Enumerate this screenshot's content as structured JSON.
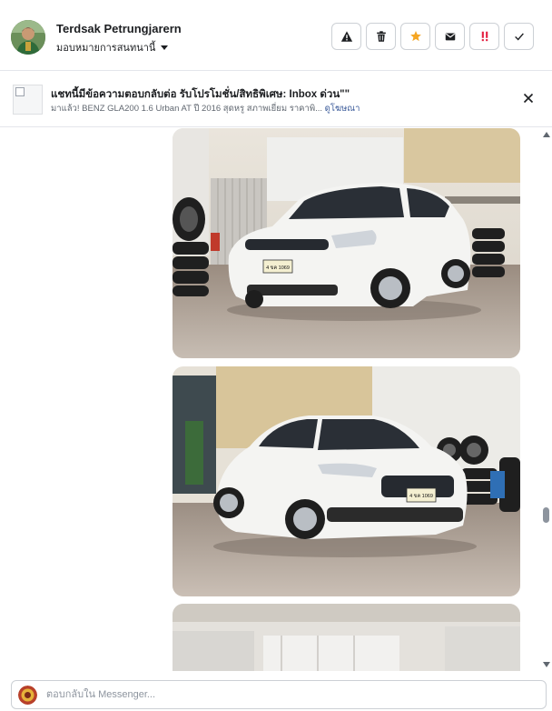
{
  "header": {
    "name": "Terdsak Petrungjarern",
    "assign_label": "มอบหมายการสนทนานี้",
    "actions": [
      {
        "name": "warning-icon",
        "label": "Mark as spam"
      },
      {
        "name": "trash-icon",
        "label": "Delete"
      },
      {
        "name": "star-icon",
        "label": "Star"
      },
      {
        "name": "envelope-icon",
        "label": "Mark as unread"
      },
      {
        "name": "exclamation-icon",
        "label": "Follow up"
      },
      {
        "name": "check-icon",
        "label": "Mark as done"
      }
    ]
  },
  "notice": {
    "title": "แชทนี้มีข้อความตอบกลับต่อ รับโปรโมชั่น/สิทธิพิเศษ: Inbox ด่วน\"\"",
    "subtitle": "มาแล้ว! BENZ GLA200 1.6 Urban AT ปี 2016 สุดหรู สภาพเยี่ยม ราคาพิ...",
    "link": "ดูโฆษณา"
  },
  "photos": [
    {
      "name": "car-photo-1",
      "alt": "White Honda HR-V in showroom, front-right view",
      "plate": "4 ขค 1069"
    },
    {
      "name": "car-photo-2",
      "alt": "White Honda HR-V in showroom, front-left view",
      "plate": "4 ขค 1069"
    },
    {
      "name": "car-photo-3",
      "alt": "Showroom interior"
    }
  ],
  "composer": {
    "placeholder": "ตอบกลับใน Messenger..."
  },
  "colors": {
    "border": "#ccd0d5",
    "star": "#f5a623",
    "alert": "#e41e3f",
    "link": "#385898"
  }
}
